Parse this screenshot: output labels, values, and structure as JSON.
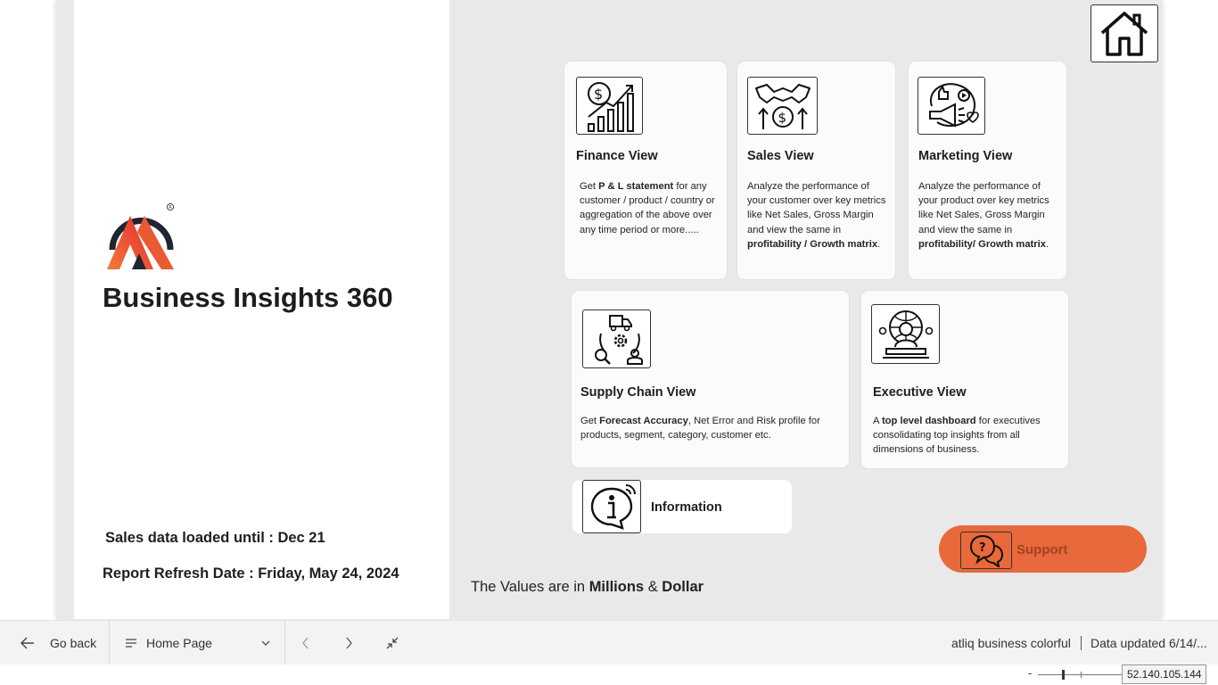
{
  "report": {
    "title": "Business Insights 360",
    "sales_loaded": "Sales data loaded until : Dec 21",
    "refresh_date": "Report Refresh Date : Friday, May 24, 2024"
  },
  "cards": {
    "finance": {
      "title": "Finance View",
      "desc_pre": "Get ",
      "desc_bold": "P & L statement",
      "desc_post": " for any customer / product / country or aggregation of the above over any time period or more....."
    },
    "sales": {
      "title": "Sales View",
      "desc_pre": "Analyze the performance of your customer over key metrics like Net Sales, Gross Margin and view the same in ",
      "desc_bold": "profitability / Growth matrix",
      "desc_post": "."
    },
    "marketing": {
      "title": "Marketing View",
      "desc_pre": "Analyze the performance of your product over key metrics like Net Sales, Gross Margin and view the same in ",
      "desc_bold": "profitability/ Growth matrix",
      "desc_post": "."
    },
    "supply_chain": {
      "title": "Supply Chain View",
      "desc_pre": "Get ",
      "desc_bold": "Forecast Accuracy",
      "desc_post": ", Net Error and Risk profile for products, segment, category, customer etc."
    },
    "executive": {
      "title": "Executive View",
      "desc_pre": "A ",
      "desc_bold": "top level dashboard",
      "desc_post": " for executives consolidating top insights from all dimensions of business."
    },
    "information": {
      "title": "Information"
    }
  },
  "support": {
    "label": "Support"
  },
  "values_note": {
    "pre": "The Values are in ",
    "millions": "Millions",
    "amp": " & ",
    "dollar": "Dollar"
  },
  "bottom_bar": {
    "go_back": "Go back",
    "page_selector": "Home Page",
    "report_name": "atliq business colorful",
    "data_updated": "Data updated 6/14/..."
  },
  "status": {
    "zoom_minus": "-",
    "ip": "52.140.105.144"
  },
  "colors": {
    "accent": "#e8693b",
    "canvas": "#e9e9e9",
    "card": "#fbfbfb"
  },
  "icons": [
    "home-icon",
    "finance-chart-icon",
    "sales-handshake-icon",
    "marketing-megaphone-icon",
    "supply-chain-icon",
    "executive-icon",
    "info-icon",
    "support-chat-icon",
    "arrow-left-icon",
    "menu-lines-icon",
    "chevron-down-icon",
    "chevron-left-icon",
    "chevron-right-icon",
    "collapse-icon"
  ]
}
